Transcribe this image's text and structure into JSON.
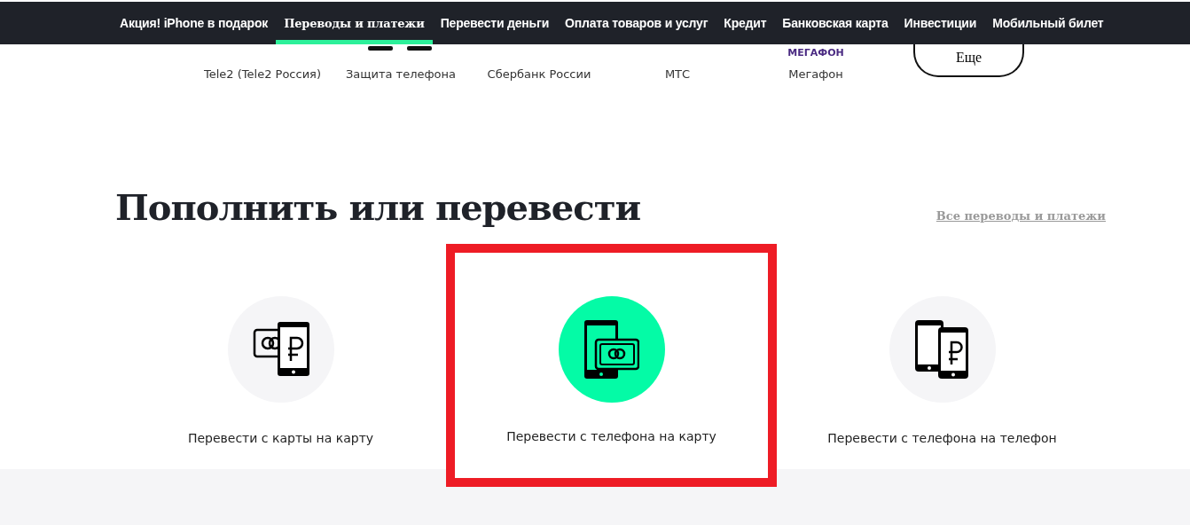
{
  "nav": {
    "items": [
      {
        "label": "Акция! iPhone в подарок",
        "selected": false
      },
      {
        "label": "Переводы и платежи",
        "selected": true
      },
      {
        "label": "Перевести деньги",
        "selected": false
      },
      {
        "label": "Оплата товаров и услуг",
        "selected": false
      },
      {
        "label": "Кредит",
        "selected": false
      },
      {
        "label": "Банковская карта",
        "selected": false
      },
      {
        "label": "Инвестиции",
        "selected": false
      },
      {
        "label": "Мобильный билет",
        "selected": false
      }
    ]
  },
  "providers": {
    "items": [
      {
        "label": "Tele2 (Tele2 Россия)",
        "kind": "blank"
      },
      {
        "label": "Защита телефона",
        "kind": "phones"
      },
      {
        "label": "Сбербанк России",
        "kind": "blank"
      },
      {
        "label": "МТС",
        "kind": "blank"
      },
      {
        "label": "Мегафон",
        "kind": "logo",
        "logo_text": "МЕГАФОН"
      }
    ],
    "more_button": "Еще"
  },
  "section": {
    "title": "Пополнить или перевести",
    "link": "Все переводы и платежи",
    "tiles": [
      {
        "label": "Перевести с карты на карту",
        "kind": "card-to-card",
        "selected": false,
        "highlighted": false
      },
      {
        "label": "Перевести с телефона на карту",
        "kind": "phone-to-card",
        "selected": true,
        "highlighted": true
      },
      {
        "label": "Перевести с телефона на телефон",
        "kind": "phone-to-phone",
        "selected": false,
        "highlighted": false
      }
    ]
  }
}
